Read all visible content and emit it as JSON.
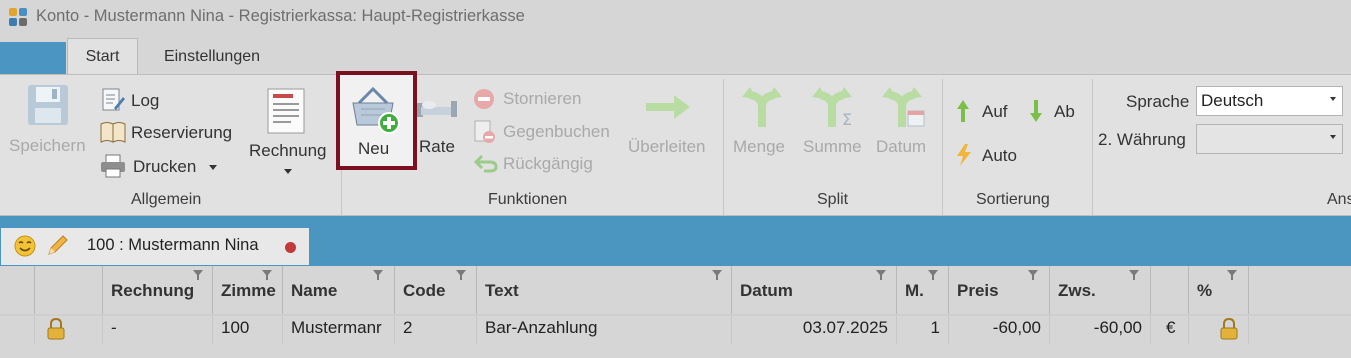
{
  "window": {
    "title": "Konto - Mustermann Nina - Registrierkassa: Haupt-Registrierkasse"
  },
  "tabs": [
    {
      "label": "Start",
      "active": true
    },
    {
      "label": "Einstellungen",
      "active": false
    }
  ],
  "ribbon": {
    "allgemein": {
      "label": "Allgemein",
      "speichern": "Speichern",
      "log": "Log",
      "reservierung": "Reservierung",
      "drucken": "Drucken",
      "rechnung": "Rechnung"
    },
    "funktionen": {
      "label": "Funktionen",
      "neu": "Neu",
      "rate": "Rate",
      "stornieren": "Stornieren",
      "gegenbuchen": "Gegenbuchen",
      "rueckgaengig": "Rückgängig",
      "ueberleiten": "Überleiten"
    },
    "split": {
      "label": "Split",
      "menge": "Menge",
      "summe": "Summe",
      "datum": "Datum"
    },
    "sortierung": {
      "label": "Sortierung",
      "auf": "Auf",
      "ab": "Ab",
      "auto": "Auto"
    },
    "ansicht": {
      "label": "Ans",
      "sprache_label": "Sprache",
      "sprache_value": "Deutsch",
      "waehrung_label": "2. Währung",
      "waehrung_value": ""
    }
  },
  "doc_tab": {
    "label": "100 :  Mustermann Nina"
  },
  "grid": {
    "columns": [
      "Rechnung",
      "Zimme",
      "Name",
      "Code",
      "Text",
      "Datum",
      "M.",
      "Preis",
      "Zws.",
      "",
      "%"
    ],
    "rows": [
      {
        "rechnung": "-",
        "zimmer": "100",
        "name": "Mustermanr",
        "code": "2",
        "text": "Bar-Anzahlung",
        "datum": "03.07.2025",
        "m": "1",
        "preis": "-60,00",
        "zws": "-60,00",
        "currency": "€"
      }
    ]
  },
  "colors": {
    "accent": "#4b96c1",
    "highlight_border": "#7a1020",
    "status_dot": "#c3393a"
  }
}
